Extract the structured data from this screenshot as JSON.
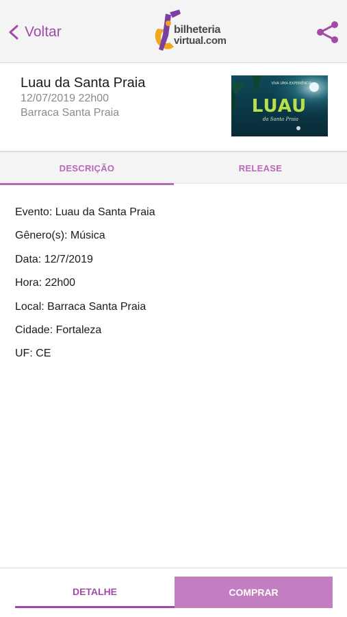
{
  "header": {
    "back_label": "Voltar",
    "logo_line1": "bilheteria",
    "logo_line2": "virtual.com",
    "share_icon": "share-icon"
  },
  "event": {
    "title": "Luau da Santa Praia",
    "datetime": "12/07/2019 22h00",
    "venue": "Barraca Santa Praia",
    "poster": {
      "top_text": "VIVA UMA EXPERIÊNCIA",
      "title": "LUAU",
      "subtitle": "da Santa Praia"
    }
  },
  "tabs": [
    {
      "label": "DESCRIÇÃO",
      "active": true
    },
    {
      "label": "RELEASE",
      "active": false
    }
  ],
  "details": [
    "Evento: Luau da Santa Praia",
    "Gênero(s): Música",
    "Data: 12/7/2019",
    "Hora: 22h00",
    "Local: Barraca Santa Praia",
    "Cidade: Fortaleza",
    "UF: CE"
  ],
  "footer": {
    "detail_label": "DETALHE",
    "buy_label": "COMPRAR"
  },
  "colors": {
    "accent": "#a24aa7",
    "accent_light": "#c37ec2",
    "poster_bg": "#0d3b4a"
  }
}
